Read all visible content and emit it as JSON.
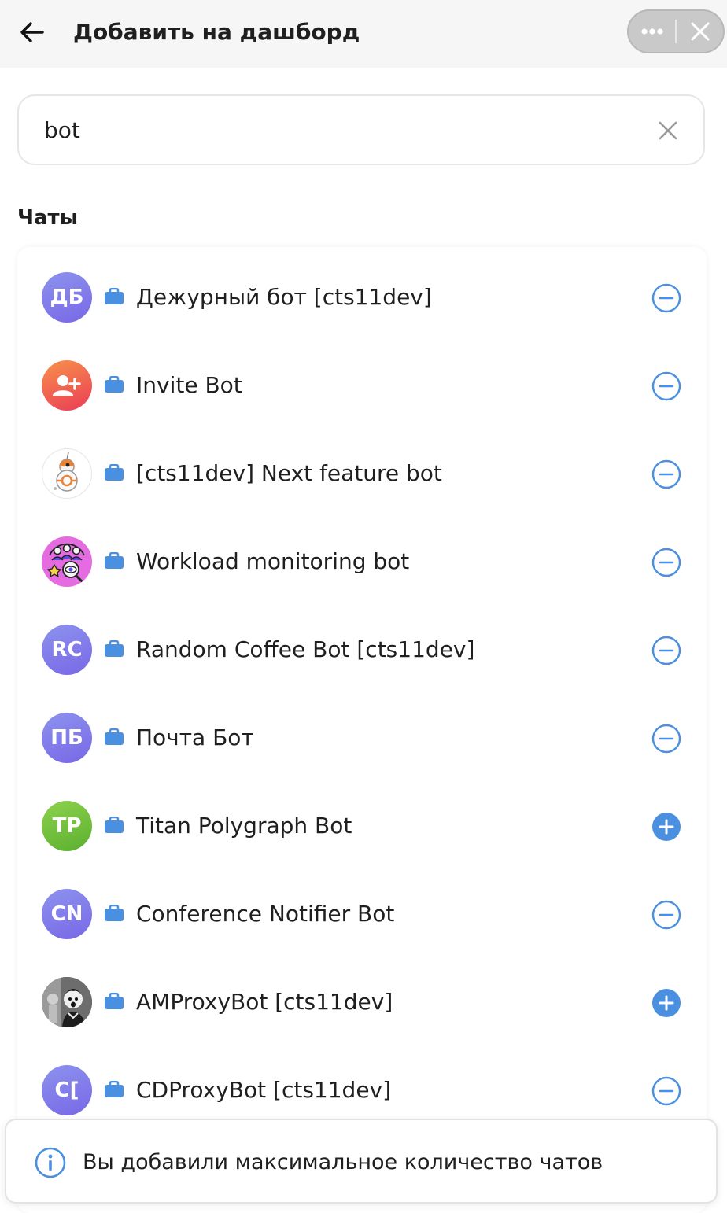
{
  "header": {
    "title": "Добавить на дашборд",
    "back_icon": "arrow-left-icon",
    "more_icon": "ellipsis-icon",
    "close_icon": "close-icon"
  },
  "search": {
    "value": "bot",
    "placeholder": "",
    "clear_icon": "clear-icon"
  },
  "section": {
    "title": "Чаты"
  },
  "colors": {
    "accent": "#4a8fe0",
    "avatar_purple": "#7c6ee8",
    "avatar_green": "#6cbe36"
  },
  "chats": [
    {
      "name": "Дежурный бот [cts11dev]",
      "initials": "ДБ",
      "avatar": "initials",
      "action": "remove"
    },
    {
      "name": "Invite Bot",
      "initials": "",
      "avatar": "invite-user-icon",
      "action": "remove"
    },
    {
      "name": "[cts11dev] Next feature bot",
      "initials": "",
      "avatar": "droid-image",
      "action": "remove"
    },
    {
      "name": "Workload monitoring bot",
      "initials": "",
      "avatar": "team-monitor-image",
      "action": "remove"
    },
    {
      "name": "Random Coffee Bot [cts11dev]",
      "initials": "RC",
      "avatar": "initials",
      "action": "remove"
    },
    {
      "name": "Почта Бот",
      "initials": "ПБ",
      "avatar": "initials",
      "action": "remove"
    },
    {
      "name": "Titan Polygraph Bot",
      "initials": "TP",
      "avatar": "initials-green",
      "action": "add"
    },
    {
      "name": "Conference Notifier Bot",
      "initials": "CN",
      "avatar": "initials",
      "action": "remove"
    },
    {
      "name": "AMProxyBot [cts11dev]",
      "initials": "",
      "avatar": "photo-image",
      "action": "add"
    },
    {
      "name": "CDProxyBot [cts11dev]",
      "initials": "C[",
      "avatar": "initials",
      "action": "remove"
    }
  ],
  "toast": {
    "text": "Вы добавили максимальное количество чатов",
    "icon": "info-icon"
  }
}
